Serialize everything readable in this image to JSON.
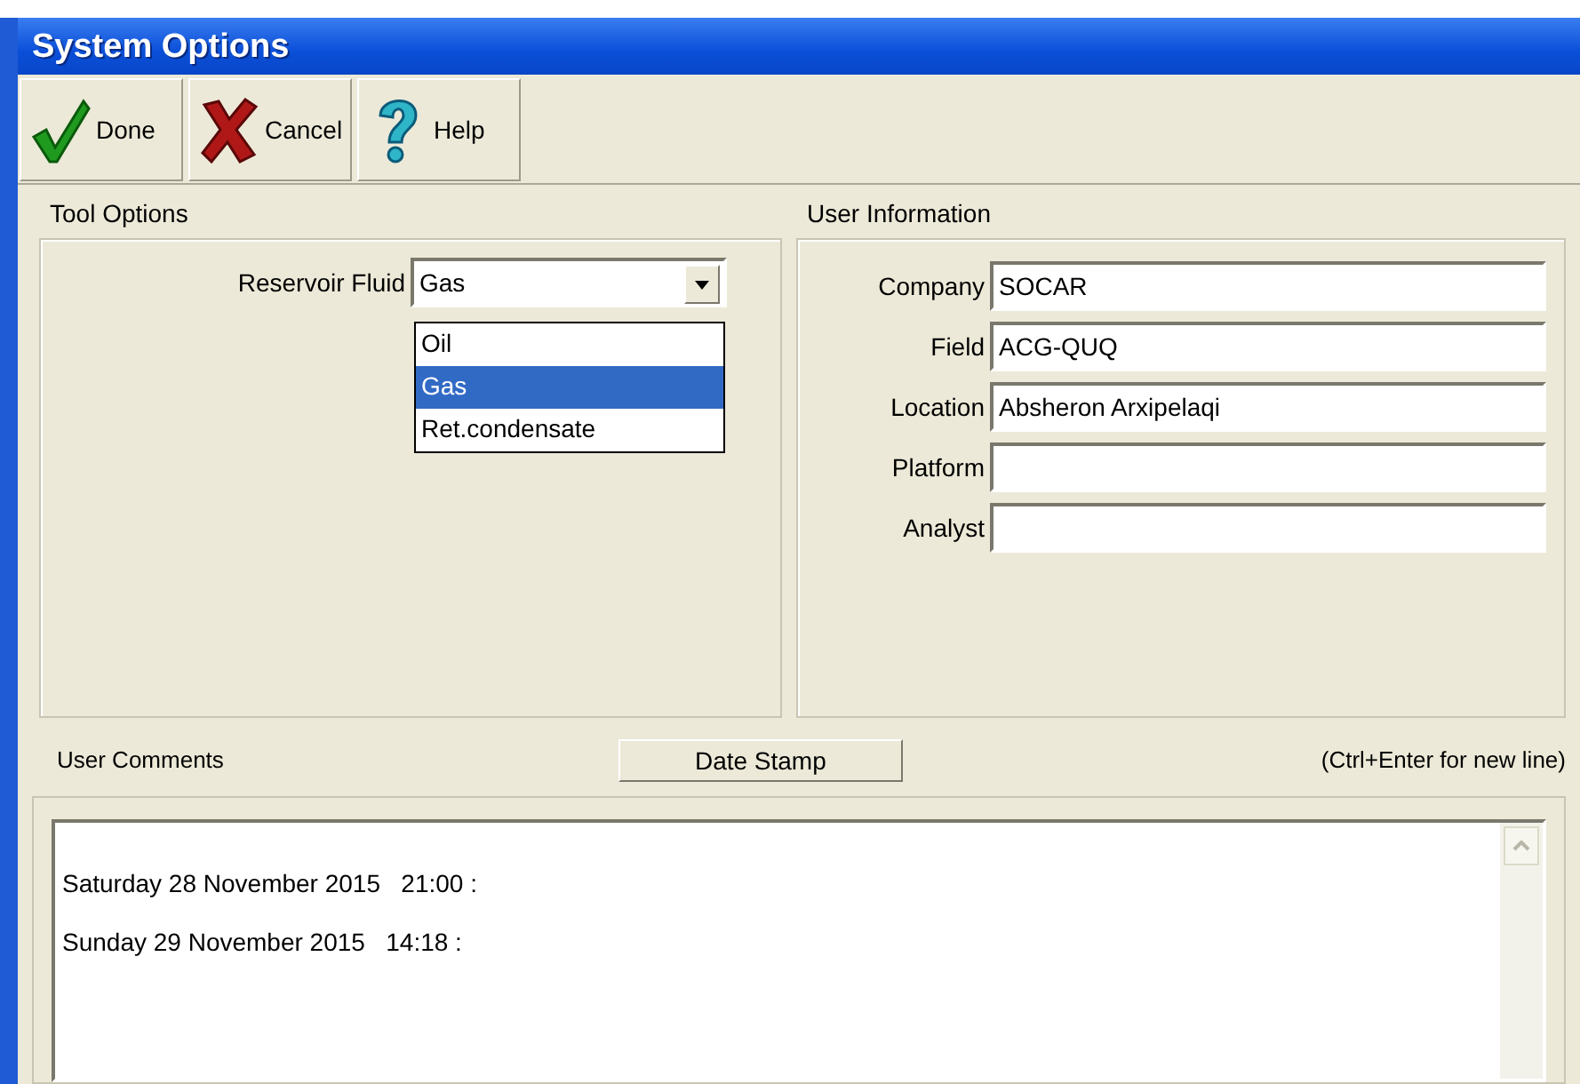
{
  "window": {
    "title": "System Options"
  },
  "toolbar": [
    {
      "kind": "done",
      "label": "Done"
    },
    {
      "kind": "cancel",
      "label": "Cancel"
    },
    {
      "kind": "help",
      "label": "Help"
    }
  ],
  "tool_options": {
    "title": "Tool Options",
    "reservoir_fluid": {
      "label": "Reservoir Fluid",
      "value": "Gas",
      "expanded": true,
      "options": [
        {
          "label": "Oil",
          "selected": false
        },
        {
          "label": "Gas",
          "selected": true
        },
        {
          "label": "Ret.condensate",
          "selected": false
        }
      ]
    }
  },
  "user_information": {
    "title": "User Information",
    "fields": [
      {
        "label": "Company",
        "value": "SOCAR"
      },
      {
        "label": "Field",
        "value": "ACG-QUQ"
      },
      {
        "label": "Location",
        "value": "Absheron Arxipelaqi"
      },
      {
        "label": "Platform"
      },
      {
        "label": "Analyst"
      }
    ]
  },
  "user_comments": {
    "title": "User Comments",
    "date_stamp_button": "Date Stamp",
    "hint": "(Ctrl+Enter for new line)",
    "lines": [
      "Saturday 28 November 2015   21:00 :",
      "Sunday 29 November 2015   14:18 :"
    ]
  }
}
